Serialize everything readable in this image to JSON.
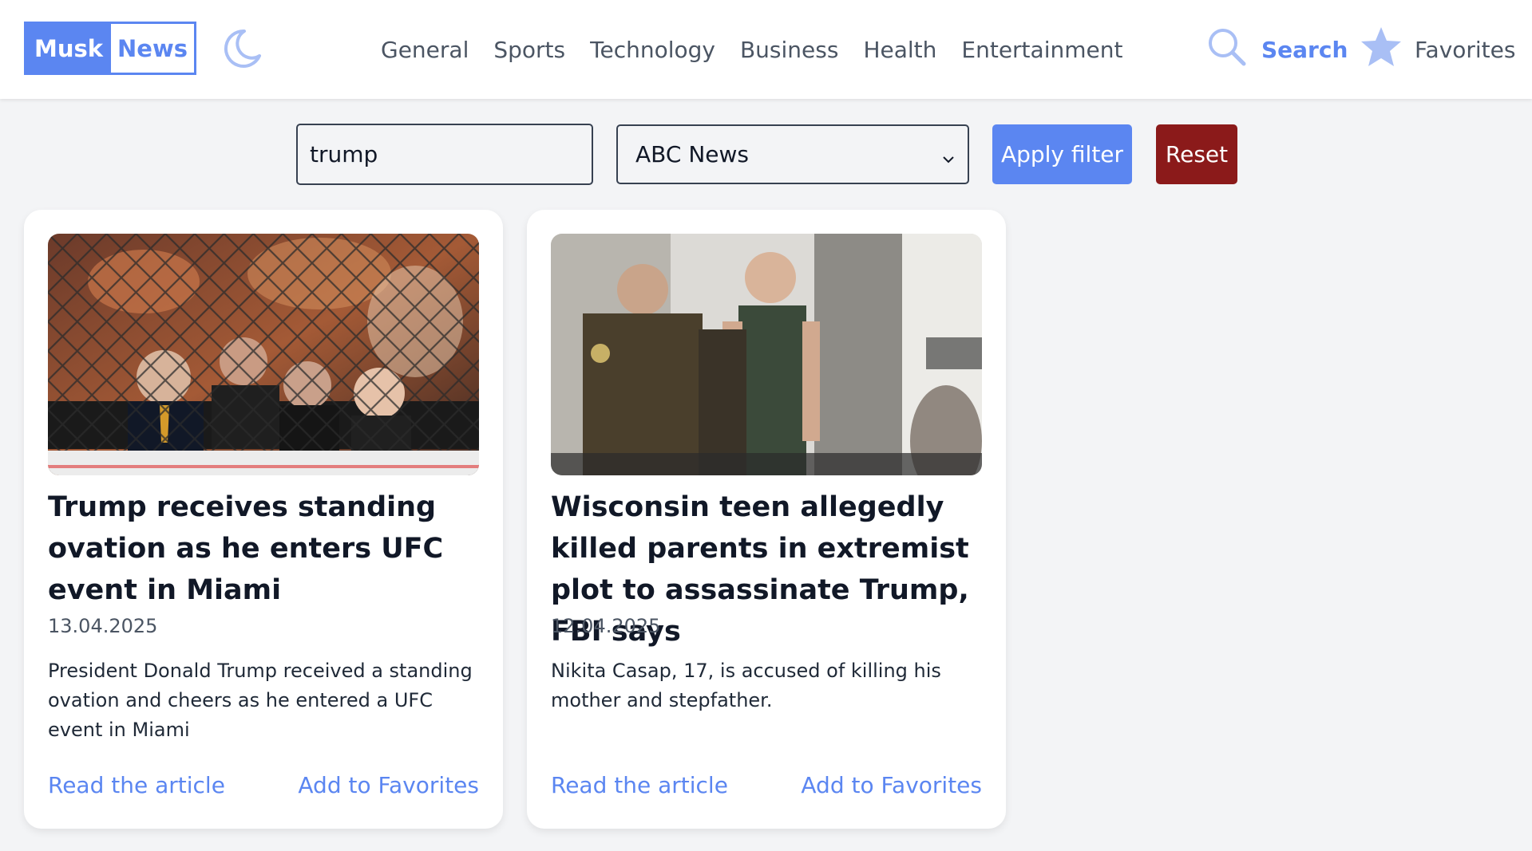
{
  "header": {
    "logo": {
      "part1": "Musk",
      "part2": "News"
    },
    "nav": [
      "General",
      "Sports",
      "Technology",
      "Business",
      "Health",
      "Entertainment"
    ],
    "search_label": "Search",
    "favorites_label": "Favorites",
    "icons": {
      "theme": "moon-icon",
      "search": "search-icon",
      "favorites": "star-icon"
    }
  },
  "filters": {
    "query_value": "trump",
    "source_selected": "ABC News",
    "apply_label": "Apply filter",
    "reset_label": "Reset"
  },
  "articles": [
    {
      "title": "Trump receives standing ovation as he enters UFC event in Miami",
      "date": "13.04.2025",
      "description": "President Donald Trump received a standing ovation and cheers as he entered a UFC event in Miami",
      "read_label": "Read the article",
      "fav_label": "Add to Favorites"
    },
    {
      "title": "Wisconsin teen allegedly killed parents in extremist plot to assassinate Trump, FBI says",
      "date": "12.04.2025",
      "description": "Nikita Casap, 17, is accused of killing his mother and stepfather.",
      "read_label": "Read the article",
      "fav_label": "Add to Favorites"
    }
  ],
  "colors": {
    "accent": "#5b86f1",
    "reset": "#8b1a1a",
    "background": "#f3f4f6"
  }
}
